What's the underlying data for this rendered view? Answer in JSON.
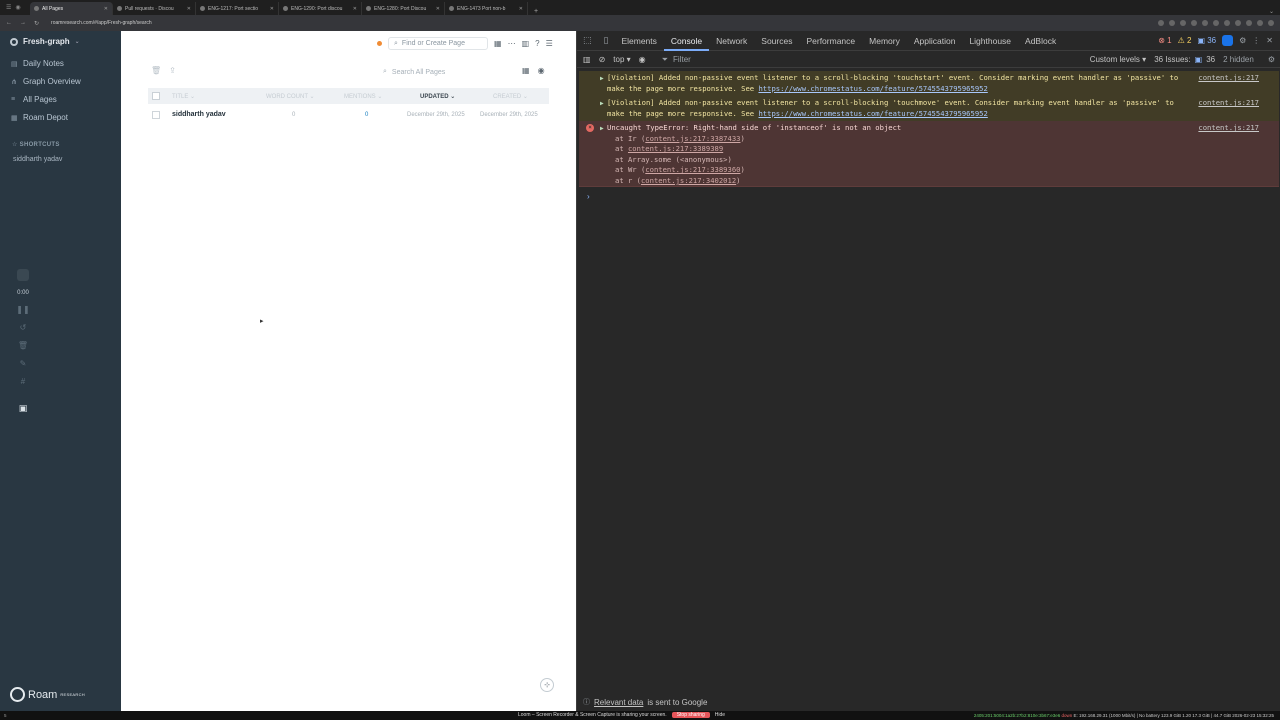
{
  "browser": {
    "tabs": [
      {
        "label": "All Pages",
        "active": true
      },
      {
        "label": "Pull requests · Discou",
        "active": false
      },
      {
        "label": "ENG-1217: Port sectio",
        "active": false
      },
      {
        "label": "ENG-1290: Port discou",
        "active": false
      },
      {
        "label": "ENG-1280: Port Discou",
        "active": false
      },
      {
        "label": "ENG-1473 Port non-b",
        "active": false
      }
    ],
    "new_tab": "+",
    "url": "roamresearch.com/#/app/Fresh-graph/search"
  },
  "sidebar": {
    "graph_name": "Fresh-graph",
    "items": [
      {
        "label": "Daily Notes",
        "icon": "calendar-icon"
      },
      {
        "label": "Graph Overview",
        "icon": "graph-icon"
      },
      {
        "label": "All Pages",
        "icon": "list-icon"
      },
      {
        "label": "Roam Depot",
        "icon": "depot-icon"
      }
    ],
    "shortcuts_heading": "SHORTCUTS",
    "shortcuts": [
      "siddharth yadav"
    ],
    "loom_time": "0:00",
    "logo_word": "Roam",
    "logo_sub": "RESEARCH"
  },
  "main": {
    "find_placeholder": "Find or Create Page",
    "search_placeholder": "Search All Pages",
    "columns": [
      "TITLE",
      "WORD COUNT",
      "MENTIONS",
      "UPDATED",
      "CREATED"
    ],
    "sorted_column": "UPDATED",
    "rows": [
      {
        "title": "siddharth yadav",
        "word_count": "0",
        "mentions": "0",
        "updated": "December 29th, 2025",
        "created": "December 29th, 2025"
      }
    ]
  },
  "devtools": {
    "tabs": [
      "Elements",
      "Console",
      "Network",
      "Sources",
      "Performance",
      "Memory",
      "Application",
      "Lighthouse",
      "AdBlock"
    ],
    "active_tab": "Console",
    "error_count": "1",
    "warning_count": "2",
    "info_count": "36",
    "context": "top",
    "filter_placeholder": "Filter",
    "levels": "Custom levels",
    "issues_label": "36 Issues:",
    "issues_count": "36",
    "hidden_label": "2 hidden",
    "messages": [
      {
        "type": "warning",
        "text": "[Violation] Added non-passive event listener to a scroll-blocking 'touchstart' event. Consider marking event handler as 'passive' to make the page more responsive. See ",
        "link": "https://www.chromestatus.com/feature/5745543795965952",
        "source": "content.js:217"
      },
      {
        "type": "warning",
        "text": "[Violation] Added non-passive event listener to a scroll-blocking 'touchmove' event. Consider marking event handler as 'passive' to make the page more responsive. See ",
        "link": "https://www.chromestatus.com/feature/5745543795965952",
        "source": "content.js:217"
      },
      {
        "type": "error",
        "text": "Uncaught TypeError: Right-hand side of 'instanceof' is not an object",
        "source": "content.js:217",
        "stack": [
          {
            "pre": "at Ir (",
            "link": "content.js:217:3387433",
            "post": ")"
          },
          {
            "pre": "at ",
            "link": "content.js:217:3389389",
            "post": ""
          },
          {
            "pre": "at Array.some (<anonymous>)",
            "link": "",
            "post": ""
          },
          {
            "pre": "at Wr (",
            "link": "content.js:217:3389360",
            "post": ")"
          },
          {
            "pre": "at r (",
            "link": "content.js:217:3402012",
            "post": ")"
          }
        ]
      }
    ],
    "relevant_link": "Relevant data",
    "relevant_text": "is sent to Google"
  },
  "system": {
    "loom_notice": "Loom – Screen Recorder & Screen Capture is sharing your screen.",
    "stop_sharing": "Stop sharing",
    "hide": "Hide",
    "status_right": "E: 192.168.29.31 (1000 Mbit/s) | No battery 123.9 GiB 1.20 17.3 GiB | 44.7 GiB 2026-02-23 15:32:25",
    "status_net": "2405:201:5004:1a2b:27b2:810e:3b67:e3e6",
    "status_down": "down"
  },
  "colors": {
    "sidebar_bg": "#293742",
    "devtools_bg": "#282828",
    "warning_bg": "#413c26",
    "error_bg": "#4e3534",
    "accent": "#7cacf8"
  }
}
